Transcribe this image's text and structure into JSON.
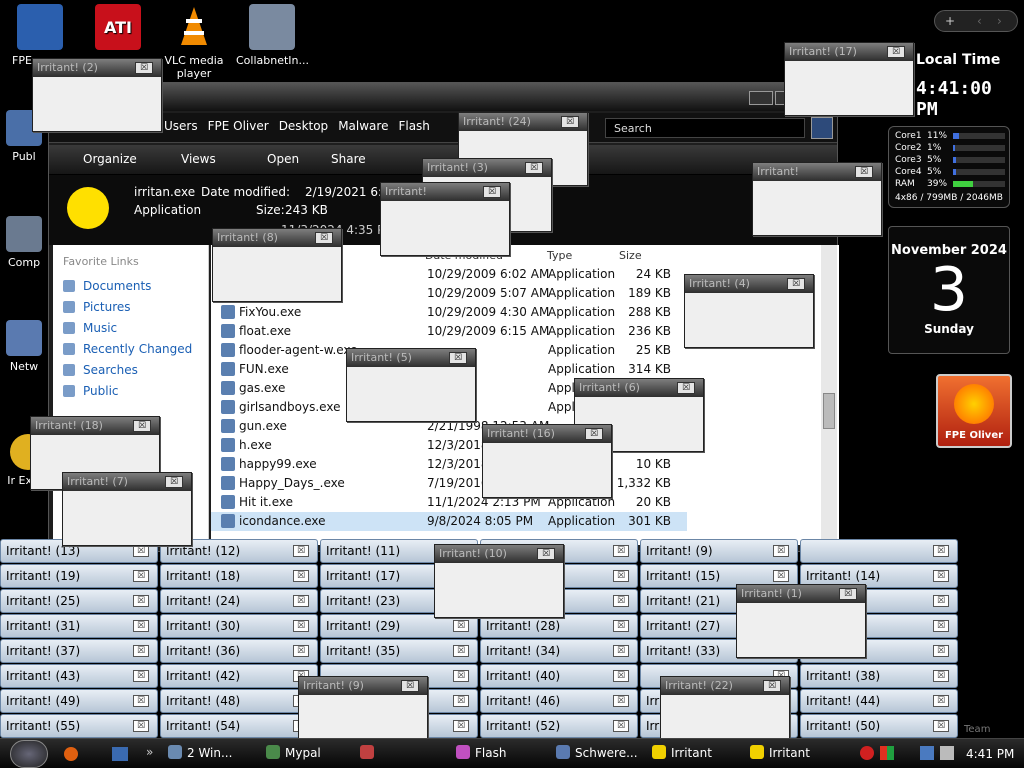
{
  "desktop_icons": [
    {
      "label": "FPE",
      "icon": "monitor-icon",
      "color": "#2b5fae"
    },
    {
      "label": "",
      "icon": "ati-radeon-icon",
      "color": "#c8101b",
      "badge": "ATI"
    },
    {
      "label": "VLC media player",
      "icon": "vlc-cone-icon",
      "color": "#f08a00"
    },
    {
      "label": "CollabnetIn...",
      "icon": "network-computer-icon",
      "color": "#7a8aa0"
    },
    {
      "label": "Publ",
      "icon": "folder-icon",
      "color": "#4a6fa8"
    },
    {
      "label": "Comp",
      "icon": "computer-icon",
      "color": "#6a7a90"
    },
    {
      "label": "Netw",
      "icon": "network-icon",
      "color": "#5a7ab0"
    },
    {
      "label": "Ir Explo",
      "icon": "internet-explorer-icon",
      "color": "#e0b020"
    }
  ],
  "top_controls": {
    "plus": "+",
    "left": "‹",
    "right": "›"
  },
  "explorer": {
    "breadcrumbs": [
      "Users",
      "FPE Oliver",
      "Desktop",
      "Malware",
      "Flash"
    ],
    "search_text": "Search",
    "toolbar": {
      "organize": "Organize",
      "views": "Views",
      "open": "Open",
      "share": "Share"
    },
    "details": {
      "name": "irritan.exe",
      "type": "Application",
      "modified_label": "Date modified:",
      "modified": "2/19/2021 6:50 AM",
      "size_label": "Size:",
      "size": "243 KB",
      "created_partial": "11/3/2024 4:35 PM"
    },
    "favorites_header": "Favorite Links",
    "favorites": [
      "Documents",
      "Pictures",
      "Music",
      "Recently Changed",
      "Searches",
      "Public"
    ],
    "columns": {
      "date": "Date modified",
      "type": "Type",
      "size": "Size"
    },
    "files": [
      {
        "name": "",
        "date": "10/29/2009 6:02 AM",
        "type": "Application",
        "size": "24 KB"
      },
      {
        "name": "",
        "date": "10/29/2009 5:07 AM",
        "type": "Application",
        "size": "189 KB"
      },
      {
        "name": "FixYou.exe",
        "date": "10/29/2009 4:30 AM",
        "type": "Application",
        "size": "288 KB"
      },
      {
        "name": "float.exe",
        "date": "10/29/2009 6:15 AM",
        "type": "Application",
        "size": "236 KB"
      },
      {
        "name": "flooder-agent-w.exe",
        "date": "",
        "type": "Application",
        "size": "25 KB"
      },
      {
        "name": "FUN.exe",
        "date": "",
        "type": "Application",
        "size": "314 KB"
      },
      {
        "name": "gas.exe",
        "date": "",
        "type": "Application",
        "size": ""
      },
      {
        "name": "girlsandboys.exe",
        "date": "",
        "type": "Application",
        "size": ""
      },
      {
        "name": "gun.exe",
        "date": "2/21/1998 12:53 AM",
        "type": "",
        "size": ""
      },
      {
        "name": "h.exe",
        "date": "12/3/2018 11:06 AM",
        "type": "",
        "size": ""
      },
      {
        "name": "happy99.exe",
        "date": "12/3/2018 2:38 AM",
        "type": "",
        "size": "10 KB"
      },
      {
        "name": "Happy_Days_.exe",
        "date": "7/19/2016 6:10 AM",
        "type": "",
        "size": "1,332 KB"
      },
      {
        "name": "Hit it.exe",
        "date": "11/1/2024 2:13 PM",
        "type": "Application",
        "size": "20 KB"
      },
      {
        "name": "icondance.exe",
        "date": "9/8/2024 8:05 PM",
        "type": "Application",
        "size": "301 KB"
      }
    ]
  },
  "popup_title": "Irritant! (?)",
  "tile_rows": [
    [
      "Irritant! (13)",
      "Irritant! (12)",
      "Irritant! (11)",
      "",
      "Irritant! (9)",
      ""
    ],
    [
      "Irritant! (19)",
      "Irritant! (18)",
      "Irritant! (17)",
      "",
      "Irritant! (15)",
      "Irritant! (14)"
    ],
    [
      "Irritant! (25)",
      "Irritant! (24)",
      "Irritant! (23)",
      "",
      "Irritant! (21)",
      ""
    ],
    [
      "Irritant! (31)",
      "Irritant! (30)",
      "Irritant! (29)",
      "Irritant! (28)",
      "Irritant! (27)",
      ""
    ],
    [
      "Irritant! (37)",
      "Irritant! (36)",
      "Irritant! (35)",
      "Irritant! (34)",
      "Irritant! (33)",
      ""
    ],
    [
      "Irritant! (43)",
      "Irritant! (42)",
      "",
      "Irritant! (40)",
      "",
      "Irritant! (38)"
    ],
    [
      "Irritant! (49)",
      "Irritant! (48)",
      "",
      "Irritant! (46)",
      "Irr",
      "Irritant! (44)"
    ],
    [
      "Irritant! (55)",
      "Irritant! (54)",
      "",
      "Irritant! (52)",
      "Irr",
      "Irritant! (50)"
    ]
  ],
  "popups": [
    {
      "title": "Irritant! (17)"
    },
    {
      "title": "Irritant! (2)"
    },
    {
      "title": "Irritant! (24)"
    },
    {
      "title": "Irritant! (3)"
    },
    {
      "title": "Irritant! (8)"
    },
    {
      "title": "Irritant! (4)"
    },
    {
      "title": "Irritant! (5)"
    },
    {
      "title": "Irritant! (6)"
    },
    {
      "title": "Irritant! (16)"
    },
    {
      "title": "Irritant! (18)"
    },
    {
      "title": "Irritant! (7)"
    },
    {
      "title": "Irritant! (1)"
    },
    {
      "title": "Irritant! (10)"
    },
    {
      "title": "Irritant! (22)"
    },
    {
      "title": "Irritant! (9)"
    },
    {
      "title": "Irritant!"
    },
    {
      "title": "Irritant!"
    }
  ],
  "gadgets": {
    "clock_title": "Local Time",
    "clock_time": "4:41:00 PM",
    "cpu": [
      {
        "label": "Core1",
        "val": "11%",
        "pct": 11
      },
      {
        "label": "Core2",
        "val": "1%",
        "pct": 1
      },
      {
        "label": "Core3",
        "val": "5%",
        "pct": 5
      },
      {
        "label": "Core4",
        "val": "5%",
        "pct": 5
      },
      {
        "label": "RAM",
        "val": "39%",
        "pct": 39
      }
    ],
    "cpu_footer": "4x86 / 799MB / 2046MB",
    "calendar_month": "November 2024",
    "calendar_day": "3",
    "calendar_weekday": "Sunday",
    "user_tile": "FPE Oliver"
  },
  "watermark_text": "Team",
  "taskbar": {
    "items": [
      {
        "label": "2 Win...",
        "icon": "windows-group-icon"
      },
      {
        "label": "Mypal",
        "icon": "mypal-icon"
      },
      {
        "label": "",
        "icon": "app-icon"
      },
      {
        "label": "Flash",
        "icon": "flash-folder-icon"
      },
      {
        "label": "Schwere...",
        "icon": "app-icon"
      },
      {
        "label": "Irritant",
        "icon": "smiley-icon"
      },
      {
        "label": "Irritant",
        "icon": "smiley-icon"
      }
    ],
    "time": "4:41 PM"
  }
}
